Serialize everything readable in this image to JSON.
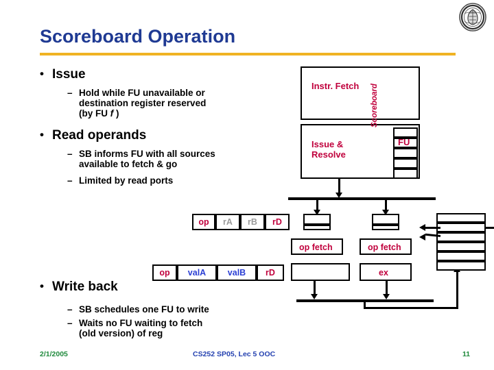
{
  "slide": {
    "title": "Scoreboard Operation",
    "accent_color": "#f0b323",
    "title_color": "#1f3a93"
  },
  "logo": {
    "name": "university-seal-logo"
  },
  "bullets": [
    {
      "label": "Issue",
      "sub": [
        "Hold while FU unavailable or destination register reserved (by FU f )"
      ]
    },
    {
      "label": "Read operands",
      "sub": [
        "SB informs FU with all sources available to fetch & go",
        "Limited by read ports"
      ]
    },
    {
      "label": "Write back",
      "sub": [
        "SB schedules one FU to write",
        "Waits no FU waiting to fetch (old version) of reg"
      ]
    }
  ],
  "bullet_text": {
    "issue_sub_line1": "Hold while FU unavailable or",
    "issue_sub_line2": "destination register reserved",
    "issue_sub_line3_pre": "(by FU ",
    "issue_sub_line3_ital": "f",
    "issue_sub_line3_post": " )",
    "read_sub1_line1": "SB informs FU with all sources",
    "read_sub1_line2": "available to fetch & go",
    "read_sub2": "Limited by read ports",
    "write_sub1": "SB schedules one FU to write",
    "write_sub2_line1": "Waits no FU waiting to fetch",
    "write_sub2_line2": "(old version) of reg"
  },
  "diagram": {
    "instr_fetch": "Instr. Fetch",
    "issue_resolve_line1": "Issue &",
    "issue_resolve_line2": "Resolve",
    "scoreboard": "Scoreboard",
    "fu": "FU",
    "op_fetch_left": "op fetch",
    "op_fetch_right": "op fetch",
    "ex": "ex",
    "instruction_register": [
      {
        "label": "op",
        "color": "#c0003c"
      },
      {
        "label": "rA",
        "color": "#9a9a9a"
      },
      {
        "label": "rB",
        "color": "#9a9a9a"
      },
      {
        "label": "rD",
        "color": "#c0003c"
      }
    ],
    "operand_register": [
      {
        "label": "op",
        "color": "#c0003c"
      },
      {
        "label": "valA",
        "color": "#2b3fd4"
      },
      {
        "label": "valB",
        "color": "#2b3fd4"
      },
      {
        "label": "rD",
        "color": "#c0003c"
      }
    ],
    "fu_stack_rows": 5,
    "regfile_rows": 6
  },
  "footer": {
    "date": "2/1/2005",
    "center": "CS252 SP05, Lec 5 OOC",
    "page": "11"
  }
}
